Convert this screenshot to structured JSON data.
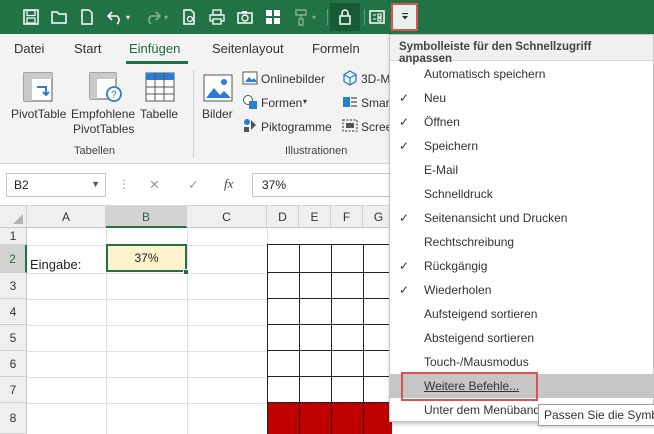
{
  "qat": {
    "icons": [
      "save-icon",
      "open-icon",
      "new-icon",
      "undo-icon",
      "redo-icon",
      "print-preview-icon",
      "print-icon",
      "camera-icon",
      "grid-icon",
      "format-painter-icon",
      "lock-icon",
      "form-icon",
      "customize-dropdown-icon"
    ],
    "colors": {
      "bar": "#217346",
      "highlight_border": "#d9534f"
    }
  },
  "tabs": [
    {
      "label": "Datei"
    },
    {
      "label": "Start"
    },
    {
      "label": "Einfügen",
      "active": true
    },
    {
      "label": "Seitenlayout"
    },
    {
      "label": "Formeln"
    }
  ],
  "ribbon": {
    "tables_group": {
      "name": "Tabellen",
      "pivottable": "PivotTable",
      "empfohlene_line1": "Empfohlene",
      "empfohlene_line2": "PivotTables",
      "tabelle": "Tabelle"
    },
    "illustrations_group": {
      "name": "Illustrationen",
      "bilder": "Bilder",
      "onlinebilder": "Onlinebilder",
      "formen": "Formen",
      "piktogramme": "Piktogramme",
      "threed": "3D-M",
      "smart": "Smar",
      "scree": "Scree"
    }
  },
  "formula_bar": {
    "name_box": "B2",
    "cancel": "✕",
    "enter": "✓",
    "fx": "fx",
    "value": "37%"
  },
  "sheet": {
    "columns": [
      "A",
      "B",
      "C",
      "D",
      "E",
      "F",
      "G"
    ],
    "rows": [
      "1",
      "2",
      "3",
      "4",
      "5",
      "6",
      "7",
      "8"
    ],
    "selected_column": "B",
    "selected_row": "2",
    "a2": "Eingabe:",
    "b2": "37%",
    "red_fill": "#c00000"
  },
  "menu": {
    "title": "Symbolleiste für den Schnellzugriff anpassen",
    "items": [
      {
        "label": "Automatisch speichern",
        "checked": false
      },
      {
        "label": "Neu",
        "checked": true
      },
      {
        "label": "Öffnen",
        "checked": true
      },
      {
        "label": "Speichern",
        "checked": true
      },
      {
        "label": "E-Mail",
        "checked": false
      },
      {
        "label": "Schnelldruck",
        "checked": false
      },
      {
        "label": "Seitenansicht und Drucken",
        "checked": true
      },
      {
        "label": "Rechtschreibung",
        "checked": false
      },
      {
        "label": "Rückgängig",
        "checked": true
      },
      {
        "label": "Wiederholen",
        "checked": true
      },
      {
        "label": "Aufsteigend sortieren",
        "checked": false
      },
      {
        "label": "Absteigend sortieren",
        "checked": false
      },
      {
        "label": "Touch-/Mausmodus",
        "checked": false
      },
      {
        "label": "Weitere Befehle...",
        "checked": false,
        "hovered": true
      },
      {
        "label": "Unter dem Menüband",
        "checked": false
      }
    ],
    "check_glyph": "✓"
  },
  "tooltip": {
    "text": "Passen Sie die Symbo"
  }
}
